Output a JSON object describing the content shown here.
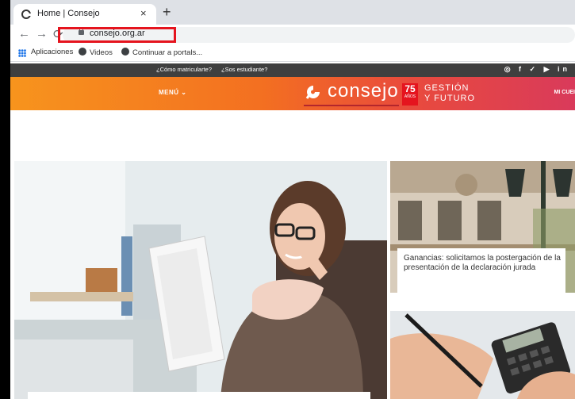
{
  "browser": {
    "tab_title": "Home | Consejo",
    "tab_close": "×",
    "new_tab": "+",
    "back": "←",
    "forward": "→",
    "reload": "⟳",
    "url": "consejo.org.ar"
  },
  "bookmarks": {
    "apps": "Aplicaciones",
    "videos": "Videos",
    "portals": "Continuar a portals..."
  },
  "site": {
    "top_links": [
      "¿Cómo matricularte?",
      "¿Sos estudiante?"
    ],
    "social_icons": "◎ f ✓ ▶ in",
    "menu_label": "MENÚ ⌄",
    "logo_text": "consejo",
    "badge_number": "75",
    "badge_sub": "AÑOS",
    "gestion_line1": "GESTIÓN",
    "gestion_line2": "Y FUTURO",
    "account_label": "MI CUEI"
  },
  "cards": [
    {
      "caption": "Ganancias: solicitamos la postergación de la presentación de la declaración jurada"
    }
  ],
  "colors": {
    "header_orange": "#f7941d",
    "header_magenta": "#d93a5b",
    "highlight_red": "#e5141e",
    "topbar_gray": "#3f3f3f"
  }
}
